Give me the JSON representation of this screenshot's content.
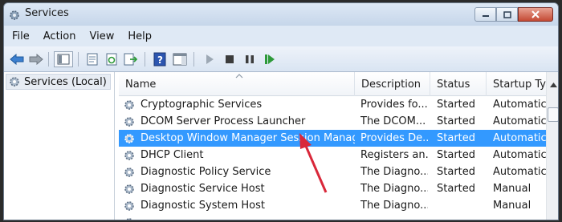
{
  "window": {
    "title": "Services"
  },
  "menu": [
    {
      "label": "File"
    },
    {
      "label": "Action"
    },
    {
      "label": "View"
    },
    {
      "label": "Help"
    }
  ],
  "toolbar": {
    "buttons": [
      "back-icon",
      "forward-icon",
      "show-hide-console-tree-icon",
      "properties-icon",
      "refresh-icon",
      "export-list-icon",
      "help-icon",
      "action-pane-icon",
      "start-icon",
      "stop-icon",
      "pause-icon",
      "restart-icon"
    ]
  },
  "tree": {
    "selected_label": "Services (Local)"
  },
  "list": {
    "columns": [
      "Name",
      "Description",
      "Status",
      "Startup Typ"
    ],
    "rows": [
      {
        "name": "Cryptographic Services",
        "description": "Provides fo...",
        "status": "Started",
        "startup": "Automatic",
        "selected": false
      },
      {
        "name": "DCOM Server Process Launcher",
        "description": "The DCOM...",
        "status": "Started",
        "startup": "Automatic",
        "selected": false
      },
      {
        "name": "Desktop Window Manager Session Manager",
        "description": "Provides De...",
        "status": "Started",
        "startup": "Automatic",
        "selected": true
      },
      {
        "name": "DHCP Client",
        "description": "Registers an...",
        "status": "Started",
        "startup": "Automatic",
        "selected": false
      },
      {
        "name": "Diagnostic Policy Service",
        "description": "The Diagno...",
        "status": "Started",
        "startup": "Automatic",
        "selected": false
      },
      {
        "name": "Diagnostic Service Host",
        "description": "The Diagno...",
        "status": "Started",
        "startup": "Manual",
        "selected": false
      },
      {
        "name": "Diagnostic System Host",
        "description": "The Diagno...",
        "status": "",
        "startup": "Manual",
        "selected": false
      }
    ]
  },
  "colors": {
    "selection": "#3399ff",
    "annotation_arrow": "#d9283a"
  }
}
